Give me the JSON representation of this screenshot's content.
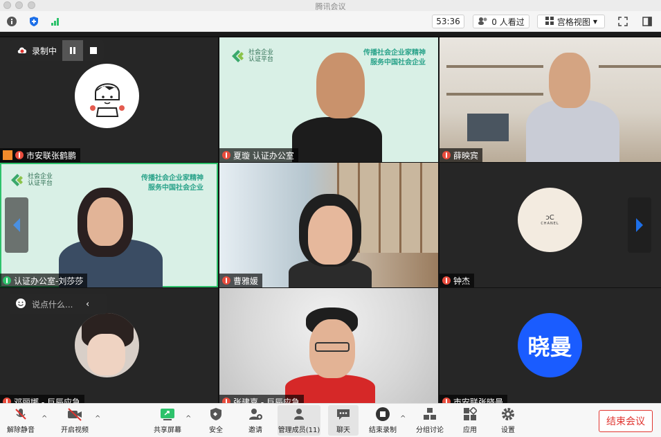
{
  "window": {
    "title": "腾讯会议"
  },
  "topbar": {
    "timer": "53:36",
    "viewers": "0 人看过",
    "view_mode": "宫格视图"
  },
  "recording": {
    "label": "录制中"
  },
  "participants": [
    {
      "name": "市安联张鹤鹏",
      "mic": "muted"
    },
    {
      "name": "夏璇 认证办公室",
      "mic": "muted"
    },
    {
      "name": "薛映宾",
      "mic": "muted"
    },
    {
      "name": "认证办公室-刘莎莎",
      "mic": "on"
    },
    {
      "name": "曹雅媛",
      "mic": "muted"
    },
    {
      "name": "钟杰",
      "mic": "muted"
    },
    {
      "name": "邓丽娜 - 巨辰应急",
      "mic": "muted"
    },
    {
      "name": "张建嘉 - 巨辰应急",
      "mic": "muted"
    },
    {
      "name": "市安联张晓曼",
      "mic": "muted",
      "avatar_text": "晓曼"
    }
  ],
  "banner": {
    "line1": "传播社会企业家精神",
    "line2": "服务中国社会企业",
    "logo_line1": "社会企业",
    "logo_line2": "认证平台"
  },
  "chat": {
    "placeholder": "说点什么..."
  },
  "chanel_text": "CHANEL",
  "toolbar": {
    "unmute": "解除静音",
    "video": "开启视频",
    "share": "共享屏幕",
    "security": "安全",
    "invite": "邀请",
    "members": "管理成员(11)",
    "chat": "聊天",
    "stop_record": "结束录制",
    "breakout": "分组讨论",
    "apps": "应用",
    "settings": "设置",
    "end_meeting": "结束会议"
  },
  "colors": {
    "accent_red": "#e0342f",
    "active_green": "#2dc26b",
    "avatar_blue": "#1a5cff"
  }
}
